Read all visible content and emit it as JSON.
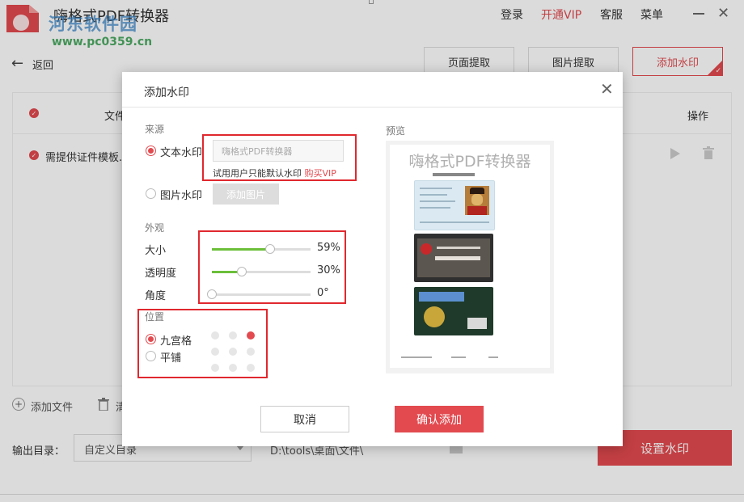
{
  "app": {
    "title": "嗨格式PDF转换器",
    "site_watermark": "河东软件园",
    "site_url": "www.pc0359.cn"
  },
  "topnav": {
    "login": "登录",
    "vip": "开通VIP",
    "service": "客服",
    "menu": "菜单"
  },
  "subbar": {
    "back": "返回",
    "page_extract": "页面提取",
    "image_extract": "图片提取",
    "add_watermark": "添加水印"
  },
  "table": {
    "col_file": "文件",
    "col_op": "操作",
    "rows": [
      {
        "name": "需提供证件模板."
      }
    ]
  },
  "bottom": {
    "add_file": "添加文件",
    "clear": "清",
    "output_dir_label": "输出目录：",
    "output_dir_select": "自定义目录",
    "output_path": "D:\\tools\\桌面\\文件\\",
    "set_watermark": "设置水印"
  },
  "dialog": {
    "title": "添加水印",
    "source_label": "来源",
    "text_wm_label": "文本水印",
    "text_wm_value": "嗨格式PDF转换器",
    "trial_note": "试用用户只能默认水印",
    "buy_vip": "购买VIP",
    "image_wm_label": "图片水印",
    "add_image": "添加图片",
    "appearance_label": "外观",
    "size_label": "大小",
    "size_value": "59%",
    "size_level": 0.59,
    "opacity_label": "透明度",
    "opacity_value": "30%",
    "opacity_level": 0.3,
    "angle_label": "角度",
    "angle_value": "0°",
    "angle_level": 0,
    "position_label": "位置",
    "nine_grid_label": "九宫格",
    "tile_label": "平铺",
    "selected_grid_cell": 2,
    "preview_label": "预览",
    "preview_watermark": "嗨格式PDF转换器",
    "cancel": "取消",
    "confirm": "确认添加"
  },
  "colors": {
    "accent": "#e24a4f",
    "slider_fill": "#6cbf3a",
    "highlight_box": "#e0282e"
  },
  "icons": {
    "back": "arrow-left-icon",
    "close": "close-icon",
    "play": "play-icon",
    "trash": "trash-icon",
    "add_file": "plus-circle-icon"
  }
}
